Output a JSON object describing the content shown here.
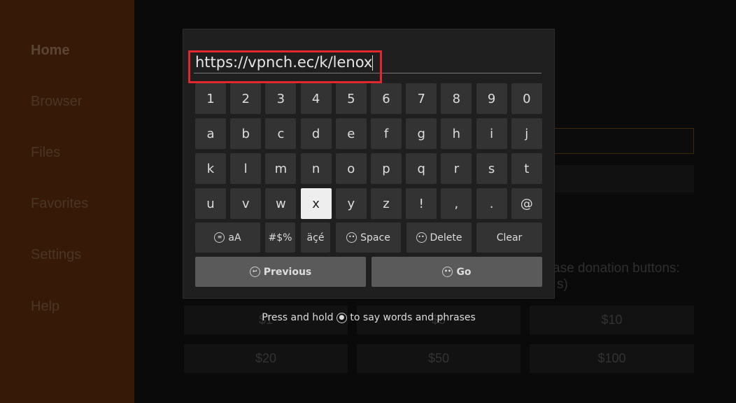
{
  "sidebar": {
    "items": [
      {
        "label": "Home"
      },
      {
        "label": "Browser"
      },
      {
        "label": "Files"
      },
      {
        "label": "Favorites"
      },
      {
        "label": "Settings"
      },
      {
        "label": "Help"
      }
    ]
  },
  "background": {
    "donation_text": "ase donation buttons:",
    "donation_text2": "s)",
    "donations": [
      "$1",
      "$5",
      "$10",
      "$20",
      "$50",
      "$100"
    ]
  },
  "keyboard": {
    "url_value": "https://vpnch.ec/k/lenox",
    "rows": [
      [
        "1",
        "2",
        "3",
        "4",
        "5",
        "6",
        "7",
        "8",
        "9",
        "0"
      ],
      [
        "a",
        "b",
        "c",
        "d",
        "e",
        "f",
        "g",
        "h",
        "i",
        "j"
      ],
      [
        "k",
        "l",
        "m",
        "n",
        "o",
        "p",
        "q",
        "r",
        "s",
        "t"
      ],
      [
        "u",
        "v",
        "w",
        "x",
        "y",
        "z",
        "!",
        ",",
        ".",
        "@"
      ]
    ],
    "selected_key": "x",
    "case_label": "aA",
    "symbols_label": "#$%",
    "accents_label": "äçé",
    "space_label": "Space",
    "delete_label": "Delete",
    "clear_label": "Clear",
    "previous_label": "Previous",
    "go_label": "Go"
  },
  "hint": {
    "before": "Press and hold",
    "after": "to say words and phrases"
  },
  "colors": {
    "highlight": "#e0282e",
    "sidebar": "#361a07"
  }
}
